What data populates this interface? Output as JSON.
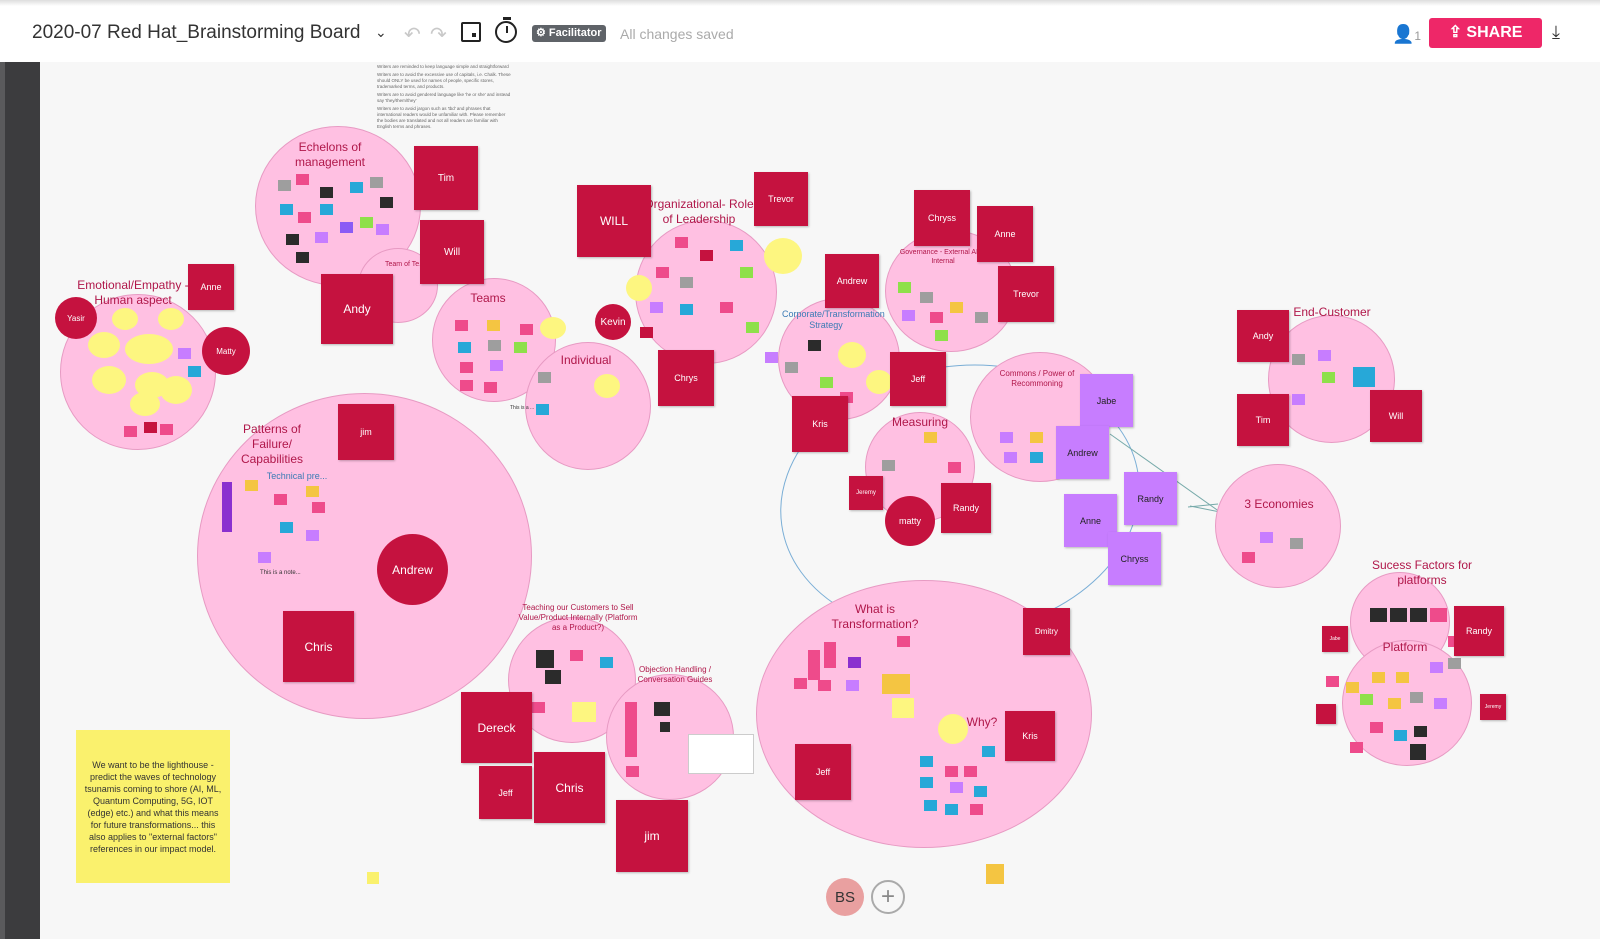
{
  "header": {
    "board_title": "2020-07 Red Hat_Brainstorming Board",
    "facilitator_label": "Facilitator",
    "status": "All changes saved",
    "user_count": "1",
    "share_label": "SHARE"
  },
  "instructions": [
    "Writers are reminded to keep language simple and straightforward",
    "Writers are to avoid the excessive use of capitals, i.e. Chalk. These should ONLY be used for names of people, specific stores, trademarked terms, and products.",
    "Writers are to avoid gendered language like 'he or she' and instead say 'they/them/they'",
    "Writers are to avoid jargon such as 'tbd' and phrases that international readers would be unfamiliar with. Please remember the bodies are translated and not all readers are familiar with English terms and phrases."
  ],
  "clusters": {
    "echelons": "Echelons of management",
    "team_of_teams": "Team of Te...",
    "emotional": "Emotional/Empathy - Human aspect",
    "teams": "Teams",
    "individual": "Individual",
    "organizational": "Organizational- Role of Leadership",
    "governance": "Governance - External AND Internal",
    "corporate": "Corporate/Transformation Strategy",
    "commons": "Commons / Power of Recommoning",
    "measuring": "Measuring",
    "end_customer": "End-Customer",
    "economies": "3 Economies",
    "patterns": "Patterns of Failure/ Capabilities",
    "technical": "Technical pre...",
    "teaching": "Teaching our Customers to Sell Value/Product Internally (Platform as a Product?)",
    "objection": "Objection Handling / Conversation Guides",
    "transformation": "What is Transformation?",
    "why": "Why?",
    "success": "Sucess Factors for platforms",
    "platform": "Platform"
  },
  "stickies": {
    "tim": "Tim",
    "will": "Will",
    "andy": "Andy",
    "anne": "Anne",
    "yasir": "Yasir",
    "matty": "Matty",
    "will_caps": "WILL",
    "trevor": "Trevor",
    "kevin": "Kevin",
    "chrys": "Chrys",
    "chryss": "Chryss",
    "andrew": "Andrew",
    "jeff": "Jeff",
    "kris": "Kris",
    "jabe": "Jabe",
    "randy": "Randy",
    "jeremy": "Jeremy",
    "matty_lc": "matty",
    "jim": "jim",
    "chris": "Chris",
    "dereck": "Dereck",
    "dmitry": "Dmitry"
  },
  "small_notes": {
    "this_is_a": "This is a ...",
    "this_is_a_note": "This is a note..."
  },
  "yellow_note": "We want to be the lighthouse - predict the waves of technology tsunamis coming to shore (AI, ML, Quantum Computing, 5G, IOT (edge) etc.) and what this means for future transformations... this also applies to \"external factors\" references in our impact model.",
  "footer": {
    "avatar_initials": "BS"
  },
  "colors": {
    "accent": "#ee2768",
    "sticky_red": "#c5123f",
    "sticky_purple": "#c77dff",
    "cluster_pink": "#ffc0e2"
  }
}
